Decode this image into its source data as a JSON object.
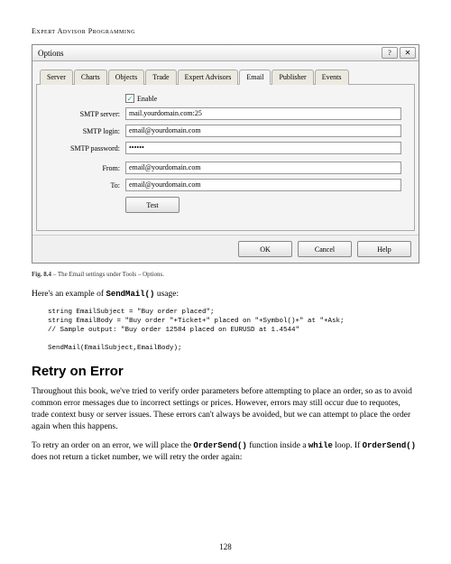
{
  "page_header": "Expert Advisor Programming",
  "dialog": {
    "title": "Options",
    "help_btn": "?",
    "close_btn": "✕",
    "tabs": [
      "Server",
      "Charts",
      "Objects",
      "Trade",
      "Expert Advisors",
      "Email",
      "Publisher",
      "Events"
    ],
    "active_tab": 5,
    "form": {
      "enable_label": "Enable",
      "enable_checked": "✓",
      "smtp_server_label": "SMTP server:",
      "smtp_server_value": "mail.yourdomain.com:25",
      "smtp_login_label": "SMTP login:",
      "smtp_login_value": "email@yourdomain.com",
      "smtp_password_label": "SMTP password:",
      "smtp_password_value": "••••••",
      "from_label": "From:",
      "from_value": "email@yourdomain.com",
      "to_label": "To:",
      "to_value": "email@yourdomain.com",
      "test_label": "Test"
    },
    "buttons": {
      "ok": "OK",
      "cancel": "Cancel",
      "help": "Help"
    }
  },
  "fig_caption_strong": "Fig. 8.4",
  "fig_caption_rest": " – The Email settings under Tools – Options.",
  "para1_a": "Here's an example of ",
  "para1_code": "SendMail()",
  "para1_b": " usage:",
  "code_block": "string EmailSubject = \"Buy order placed\";\nstring EmailBody = \"Buy order \"+Ticket+\" placed on \"+Symbol()+\" at \"+Ask;\n// Sample output: \"Buy order 12584 placed on EURUSD at 1.4544\"\n\nSendMail(EmailSubject,EmailBody);",
  "section_heading": "Retry on Error",
  "para2": "Throughout this book, we've tried to verify order parameters before attempting to place an order, so as to avoid common error messages due to incorrect settings or prices. However, errors may still occur due to requotes, trade context busy or server issues. These errors can't always be avoided, but we can attempt to place the order again when this happens.",
  "para3_a": "To retry an order on an error, we will place the ",
  "para3_code1": "OrderSend()",
  "para3_b": " function inside a ",
  "para3_code2": "while",
  "para3_c": " loop. If ",
  "para3_code3": "OrderSend()",
  "para3_d": " does not return a ticket number, we will retry the order again:",
  "page_number": "128"
}
